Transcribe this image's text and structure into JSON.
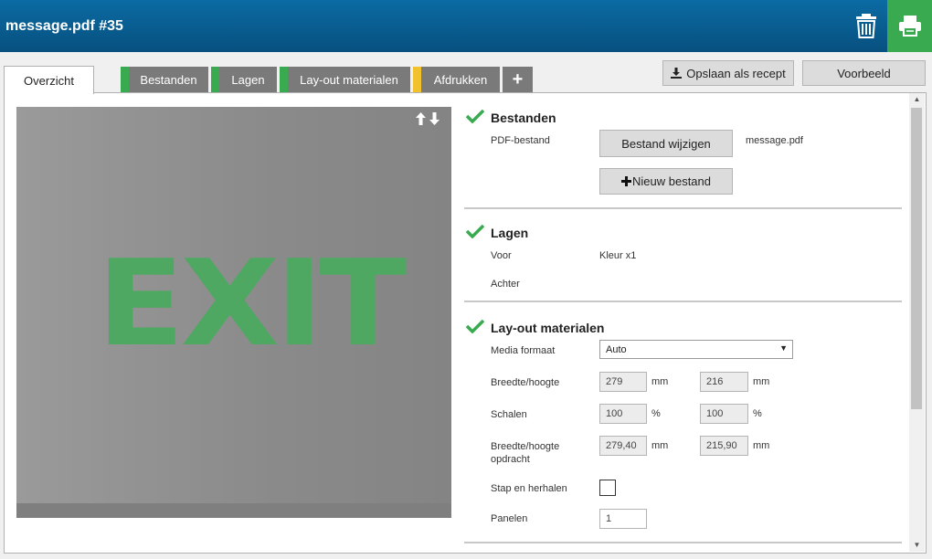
{
  "header": {
    "title": "message.pdf #35"
  },
  "tabs": {
    "overview": "Overzicht",
    "items": [
      {
        "label": "Bestanden",
        "status_color": "#3aaa50"
      },
      {
        "label": "Lagen",
        "status_color": "#3aaa50"
      },
      {
        "label": "Lay-out materialen",
        "status_color": "#3aaa50"
      },
      {
        "label": "Afdrukken",
        "status_color": "#f2c12e"
      }
    ],
    "add": "+"
  },
  "toolbar": {
    "save_recipe": "Opslaan als recept",
    "preview": "Voorbeeld"
  },
  "preview": {
    "text": "EXIT",
    "text_color": "#4ea861"
  },
  "sections": {
    "files": {
      "title": "Bestanden",
      "pdf_label": "PDF-bestand",
      "change_button": "Bestand wijzigen",
      "filename": "message.pdf",
      "new_button": "Nieuw bestand"
    },
    "layers": {
      "title": "Lagen",
      "front_label": "Voor",
      "front_value": "Kleur x1",
      "back_label": "Achter"
    },
    "layout": {
      "title": "Lay-out materialen",
      "media_format_label": "Media formaat",
      "media_format_value": "Auto",
      "size_label": "Breedte/hoogte",
      "width": "279",
      "height": "216",
      "unit_mm": "mm",
      "scale_label": "Schalen",
      "scale_x": "100",
      "scale_y": "100",
      "unit_pct": "%",
      "job_size_label_1": "Breedte/hoogte",
      "job_size_label_2": "opdracht",
      "job_width": "279,40",
      "job_height": "215,90",
      "step_repeat_label": "Stap en herhalen",
      "panels_label": "Panelen",
      "panels_value": "1"
    }
  }
}
